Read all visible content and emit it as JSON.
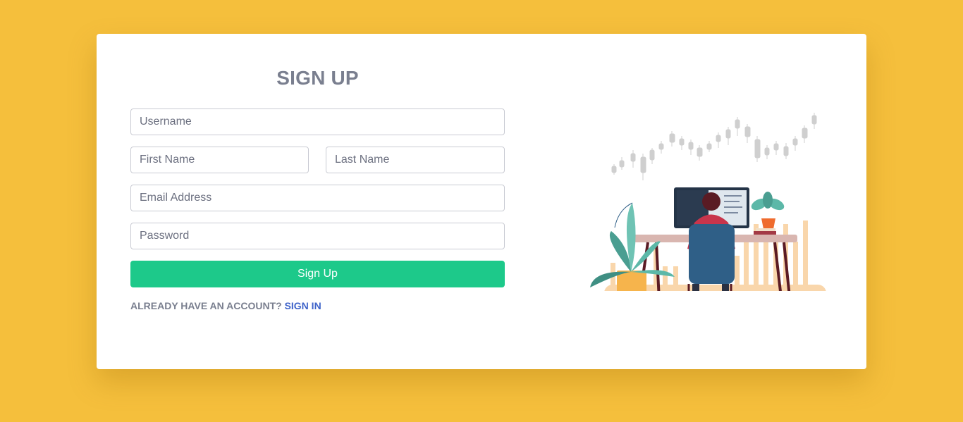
{
  "signup": {
    "title": "SIGN UP",
    "username_placeholder": "Username",
    "firstname_placeholder": "First Name",
    "lastname_placeholder": "Last Name",
    "email_placeholder": "Email Address",
    "password_placeholder": "Password",
    "submit_label": "Sign Up",
    "account_prompt": "ALREADY HAVE AN ACCOUNT?",
    "signin_label": "SIGN IN"
  },
  "colors": {
    "background": "#f5bf3c",
    "card": "#ffffff",
    "button": "#1dc98a",
    "link": "#3e63c9",
    "text": "#7a7f8f"
  },
  "illustration": {
    "description_icon": "person-at-computer-illustration"
  }
}
